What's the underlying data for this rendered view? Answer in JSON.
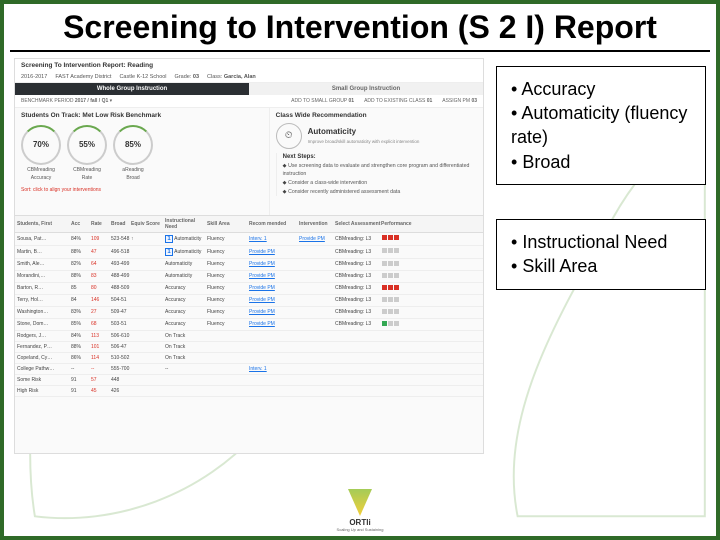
{
  "title": "Screening to Intervention (S 2 I) Report",
  "screenshot": {
    "report_title": "Screening To Intervention Report: Reading",
    "period": "2016-2017",
    "district": "FAST Academy District",
    "school": "Castle K-12 School",
    "grade_label": "Grade:",
    "grade_value": "03",
    "teacher_label": "Class:",
    "teacher_value": "Garcia, Alan",
    "tab_active": "Whole Group Instruction",
    "tab_inactive": "Small Group Instruction",
    "filter_benchmark": "BENCHMARK PERIOD",
    "filter_benchmark_v": "2017 / fall / Q1",
    "filter_smallgroup": "ADD TO SMALL GROUP",
    "filter_smallgroup_v": "01",
    "filter_class": "ADD TO EXISTING CLASS",
    "filter_class_v": "01",
    "filter_assign": "ASSIGN PM",
    "filter_assign_v": "03",
    "on_track_heading": "Students On Track: Met Low Risk Benchmark",
    "class_recommend": "Class Wide Recommendation",
    "next_steps_label": "Next Steps:",
    "next_steps": [
      "Use screening data to evaluate and strengthen core program and differentiated instruction",
      "Consider a class-wide intervention",
      "Consider recently administered assessment data"
    ],
    "gauges": [
      {
        "value": "70%",
        "label": "CBMreading",
        "sub": "Accuracy"
      },
      {
        "value": "55%",
        "label": "CBMreading",
        "sub": "Rate"
      },
      {
        "value": "85%",
        "label": "aReading",
        "sub": "Broad"
      }
    ],
    "big_metric_label": "Automaticity",
    "big_metric_sub": "Improve broad/skill automaticity with explicit intervention",
    "red_callout": "Sort: click to align your interventions",
    "table": {
      "headers": [
        "Students, First",
        "Acc",
        "Rate",
        "Broad",
        "Equiv Score",
        "Instructional Need",
        "Skill Area",
        "Recom mended",
        "Intervention",
        "Select Assessment",
        "Performance"
      ],
      "rows": [
        {
          "name": "Sousa, Pat…",
          "acc": "84%",
          "rate": "109",
          "broad": "523-548",
          "trend": "↑",
          "need": "1",
          "skill": "Automaticity",
          "area": "Fluency",
          "rec": "Interv. 1",
          "pm": "Provide PM",
          "assess": "CBMreading: L3",
          "perf": "rrr"
        },
        {
          "name": "Martin, B…",
          "acc": "88%",
          "rate": "47",
          "broad": "496-518",
          "trend": "",
          "need": "1",
          "skill": "Automaticity",
          "area": "Fluency",
          "rec": "",
          "pm": "Provide PM",
          "assess": "CBMreading: L3",
          "perf": "gry"
        },
        {
          "name": "Smith, Ale…",
          "acc": "82%",
          "rate": "64",
          "broad": "493-499",
          "trend": "",
          "need": "",
          "skill": "Automaticity",
          "area": "Fluency",
          "rec": "",
          "pm": "Provide PM",
          "assess": "CBMreading: L3",
          "perf": "gry"
        },
        {
          "name": "Morandini,…",
          "acc": "88%",
          "rate": "83",
          "broad": "488-499",
          "trend": "",
          "need": "",
          "skill": "Automaticity",
          "area": "Fluency",
          "rec": "",
          "pm": "Provide PM",
          "assess": "CBMreading: L3",
          "perf": "gry"
        },
        {
          "name": "Barton, R…",
          "acc": "85",
          "rate": "80",
          "broad": "488-509",
          "trend": "",
          "need": "",
          "skill": "Accuracy",
          "area": "Fluency",
          "rec": "",
          "pm": "Provide PM",
          "assess": "CBMreading: L3",
          "perf": "rrr"
        },
        {
          "name": "Terry, Hol…",
          "acc": "84",
          "rate": "146",
          "broad": "504-51",
          "trend": "",
          "need": "",
          "skill": "Accuracy",
          "area": "Fluency",
          "rec": "",
          "pm": "Provide PM",
          "assess": "CBMreading: L3",
          "perf": "gry"
        },
        {
          "name": "Washington…",
          "acc": "83%",
          "rate": "27",
          "broad": "509-47",
          "trend": "",
          "need": "",
          "skill": "Accuracy",
          "area": "Fluency",
          "rec": "",
          "pm": "Provide PM",
          "assess": "CBMreading: L3",
          "perf": "gry"
        },
        {
          "name": "Stone, Dom…",
          "acc": "85%",
          "rate": "68",
          "broad": "503-51",
          "trend": "",
          "need": "",
          "skill": "Accuracy",
          "area": "Fluency",
          "rec": "",
          "pm": "Provide PM",
          "assess": "CBMreading: L3",
          "perf": "grn"
        },
        {
          "name": "Rodgers, J…",
          "acc": "84%",
          "rate": "113",
          "broad": "506-610",
          "trend": "",
          "need": "",
          "skill": "On Track",
          "area": "",
          "rec": "",
          "pm": "",
          "assess": "",
          "perf": ""
        },
        {
          "name": "Fernandez, P…",
          "acc": "88%",
          "rate": "101",
          "broad": "506-47",
          "trend": "",
          "need": "",
          "skill": "On Track",
          "area": "",
          "rec": "",
          "pm": "",
          "assess": "",
          "perf": ""
        },
        {
          "name": "Copeland, Cy…",
          "acc": "86%",
          "rate": "114",
          "broad": "510-502",
          "trend": "",
          "need": "",
          "skill": "On Track",
          "area": "",
          "rec": "",
          "pm": "",
          "assess": "",
          "perf": ""
        },
        {
          "name": "College Pathw…",
          "acc": "--",
          "rate": "--",
          "broad": "555-700",
          "trend": "",
          "need": "",
          "skill": "--",
          "area": "",
          "rec": "",
          "pm": "Interv. 1",
          "assess": "",
          "perf": ""
        },
        {
          "name": "Some Risk",
          "acc": "91",
          "rate": "57",
          "broad": "448",
          "trend": "",
          "need": "",
          "skill": "",
          "area": "",
          "rec": "",
          "pm": "",
          "assess": "",
          "perf": ""
        },
        {
          "name": "High Risk",
          "acc": "91",
          "rate": "45",
          "broad": "426",
          "trend": "",
          "need": "",
          "skill": "",
          "area": "",
          "rec": "",
          "pm": "",
          "assess": "",
          "perf": ""
        }
      ]
    }
  },
  "bullet_box_1": {
    "items": [
      "Accuracy",
      "Automaticity (fluency rate)",
      "Broad"
    ]
  },
  "bullet_box_2": {
    "items": [
      "Instructional Need",
      "Skill Area"
    ]
  },
  "logo": {
    "text": "ORTIi",
    "sub": "Scaling Up and Sustaining"
  }
}
